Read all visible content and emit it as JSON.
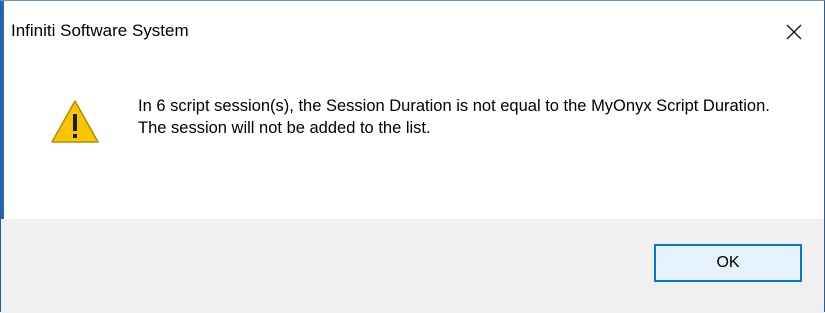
{
  "window": {
    "title": "Infiniti Software System",
    "close_icon": "close-icon"
  },
  "message": {
    "icon": "warning-icon",
    "text": "In 6 script session(s), the Session Duration is not equal to the MyOnyx Script Duration. The session will not be added to the list."
  },
  "buttons": {
    "ok_label": "OK"
  },
  "colors": {
    "accent": "#0078d7",
    "footer_bg": "#f0f0f0",
    "warning_fill": "#f7c600"
  }
}
